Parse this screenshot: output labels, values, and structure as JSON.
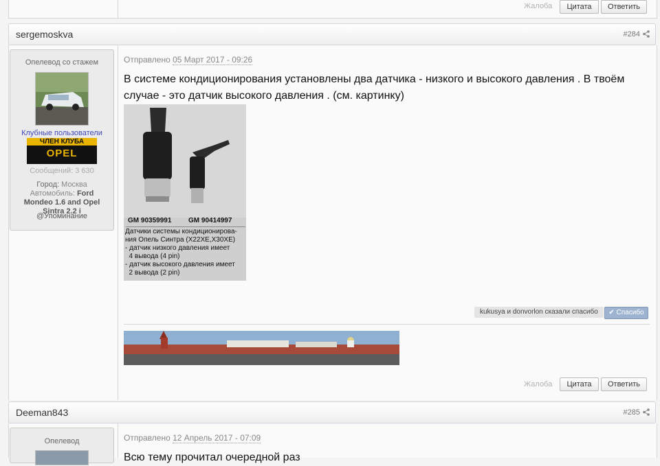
{
  "prev_post": {
    "report_label": "Жалоба",
    "quote_label": "Цитата",
    "reply_label": "Ответить"
  },
  "post1": {
    "author": "sergemoskva",
    "number": "#284",
    "user": {
      "rank": "Опелевод со стажем",
      "group": "Клубные пользователи",
      "badge_top": "ЧЛЕН КЛУБА",
      "badge_logo": "OPEL",
      "messages": "Сообщений: 3 630",
      "city_label": "Город:",
      "city": "Москва",
      "car_label": "Автомобиль:",
      "car": "Ford Mondeo 1.6 and Opel Sintra 2.2 i",
      "mention": "@Упоминание"
    },
    "posted_label": "Отправлено",
    "posted_date": "05 Март 2017 - 09:26",
    "text": "В системе кондиционирования установлены два датчика - низкого и высокого давления . В твоём случае - это датчик высокого давления . (см. картинку)",
    "image": {
      "label_left": "GM 90359991",
      "label_right": "GM 90414997",
      "caption": [
        "Датчики системы кондиционирова-",
        "ния Опель Синтра (X22XE,X30XE)",
        "- датчик низкого давления имеет",
        "  4 вывода (4 pin)",
        "- датчик высокого давления имеет",
        "  2 вывода (2 pin)"
      ]
    },
    "thanks_text": "kukusya и donvorlon сказали спасибо",
    "thanks_button": "Спасибо",
    "report_label": "Жалоба",
    "quote_label": "Цитата",
    "reply_label": "Ответить"
  },
  "post2": {
    "author": "Deeman843",
    "number": "#285",
    "user": {
      "rank": "Опелевод"
    },
    "posted_label": "Отправлено",
    "posted_date": "12 Апрель 2017 - 07:09",
    "text": "Всю тему прочитал очередной раз"
  },
  "colors": {
    "link": "#3b5ea8",
    "group": "#3d47b8",
    "thanks_button": "#9db3cf"
  }
}
